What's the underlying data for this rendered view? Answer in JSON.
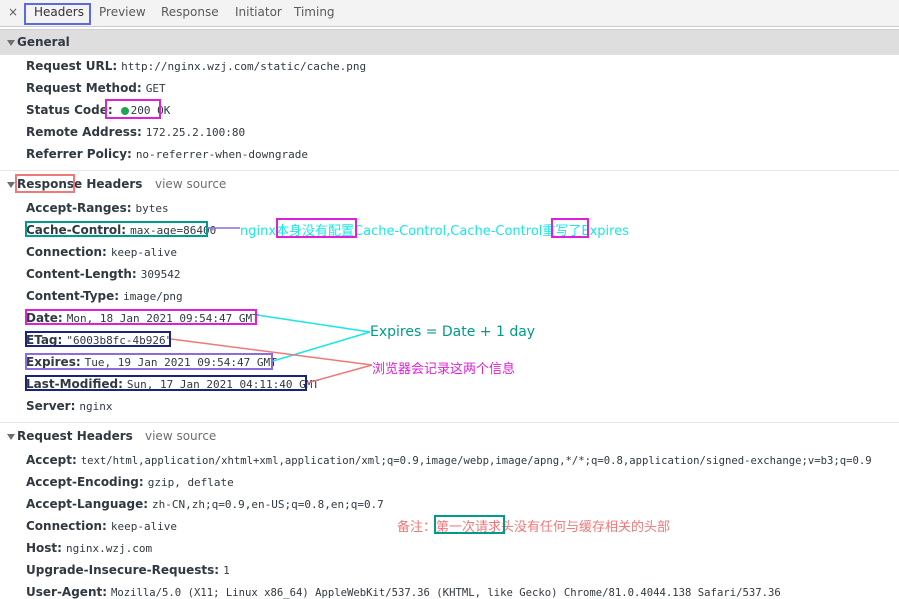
{
  "tabs": {
    "close": "×",
    "items": [
      "Headers",
      "Preview",
      "Response",
      "Initiator",
      "Timing"
    ]
  },
  "general": {
    "title": "General",
    "rows": [
      {
        "key": "Request URL:",
        "value": "http://nginx.wzj.com/static/cache.png"
      },
      {
        "key": "Request Method:",
        "value": "GET"
      },
      {
        "key": "Status Code:",
        "value": "200 OK"
      },
      {
        "key": "Remote Address:",
        "value": "172.25.2.100:80"
      },
      {
        "key": "Referrer Policy:",
        "value": "no-referrer-when-downgrade"
      }
    ]
  },
  "response_headers": {
    "title_part1": "Response",
    "title_part2": " Headers",
    "view_source": "view source",
    "rows": [
      {
        "key": "Accept-Ranges:",
        "value": "bytes"
      },
      {
        "key": "Cache-Control:",
        "value": "max-age=86400"
      },
      {
        "key": "Connection:",
        "value": "keep-alive"
      },
      {
        "key": "Content-Length:",
        "value": "309542"
      },
      {
        "key": "Content-Type:",
        "value": "image/png"
      },
      {
        "key": "Date:",
        "value": "Mon, 18 Jan 2021 09:54:47 GMT"
      },
      {
        "key": "ETag:",
        "value": "\"6003b8fc-4b926\""
      },
      {
        "key": "Expires:",
        "value": "Tue, 19 Jan 2021 09:54:47 GMT"
      },
      {
        "key": "Last-Modified:",
        "value": "Sun, 17 Jan 2021 04:11:40 GMT"
      },
      {
        "key": "Server:",
        "value": "nginx"
      }
    ]
  },
  "request_headers": {
    "title": "Request Headers",
    "view_source": "view source",
    "rows": [
      {
        "key": "Accept:",
        "value": "text/html,application/xhtml+xml,application/xml;q=0.9,image/webp,image/apng,*/*;q=0.8,application/signed-exchange;v=b3;q=0.9"
      },
      {
        "key": "Accept-Encoding:",
        "value": "gzip, deflate"
      },
      {
        "key": "Accept-Language:",
        "value": "zh-CN,zh;q=0.9,en-US;q=0.8,en;q=0.7"
      },
      {
        "key": "Connection:",
        "value": "keep-alive"
      },
      {
        "key": "Host:",
        "value": "nginx.wzj.com"
      },
      {
        "key": "Upgrade-Insecure-Requests:",
        "value": "1"
      },
      {
        "key": "User-Agent:",
        "value": "Mozilla/5.0 (X11; Linux x86_64) AppleWebKit/537.36 (KHTML, like Gecko) Chrome/81.0.4044.138 Safari/537.36"
      }
    ]
  },
  "annotations": {
    "cache_control_note": "nginx本身没有配置Cache-Control,Cache-Control重写了Expires",
    "expires_note": "Expires = Date + 1 day",
    "browser_note": "浏览器会记录这两个信息",
    "request_note": "备注：第一次请求头没有任何与缓存相关的头部"
  },
  "colors": {
    "cyan": "#19e6e6",
    "teal": "#009b8a",
    "magenta": "#e020d8",
    "salmon": "#f07878",
    "navy": "#1a237e",
    "blue": "#5b6bdf",
    "status_green": "#1aa84d"
  }
}
